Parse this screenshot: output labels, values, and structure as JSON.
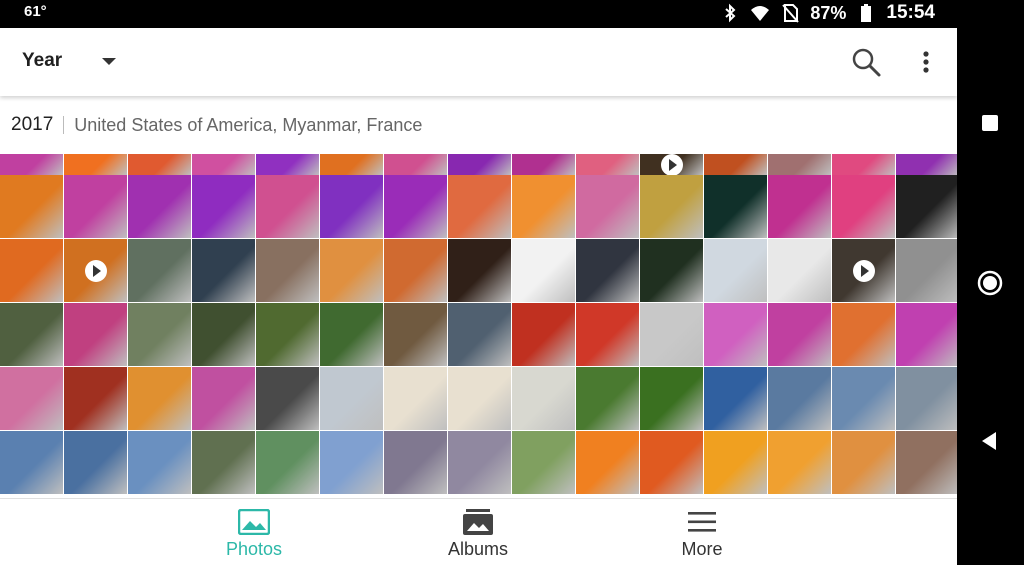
{
  "status_bar": {
    "temperature": "61°",
    "battery": "87%",
    "time": "15:54",
    "icons": [
      "bluetooth-icon",
      "wifi-icon",
      "no-sim-icon",
      "battery-icon"
    ]
  },
  "app_bar": {
    "view_label": "Year",
    "icons": [
      "chevron-down-icon",
      "search-icon",
      "more-vert-icon"
    ]
  },
  "section": {
    "year": "2017",
    "places": "United States of America, Myanmar, France"
  },
  "grid": {
    "row_count": 6,
    "columns": 15,
    "tiles": [
      [
        "#c040a0",
        "#f07020",
        "#e05a30",
        "#d050a0",
        "#9030c0",
        "#e07020",
        "#d05090",
        "#8828b0",
        "#b03090",
        "#e06080",
        "#403020",
        "#c05020",
        "#a07070",
        "#e04a80",
        "#9030b0"
      ],
      [
        "#e07a20",
        "#c040a0",
        "#a030b0",
        "#8f2cc0",
        "#d05090",
        "#8030c0",
        "#9a2cb8",
        "#e06a40",
        "#f09030",
        "#d06aa0",
        "#c0a040",
        "#10302a",
        "#c03090",
        "#e04080",
        "#202020"
      ],
      [
        "#e06a20",
        "#d07020",
        "#607060",
        "#304050",
        "#887060",
        "#e09040",
        "#d06a30",
        "#302018",
        "#f2f2f2",
        "#303540",
        "#203020",
        "#d0d8e0",
        "#e8e8e8",
        "#403830",
        "#909090"
      ],
      [
        "#506040",
        "#c04080",
        "#708060",
        "#405030",
        "#506a30",
        "#406a30",
        "#705a40",
        "#506070",
        "#c03020",
        "#d03828",
        "#c8c8c8",
        "#d060c0",
        "#c040a0",
        "#e07030",
        "#c040b0"
      ],
      [
        "#d070a0",
        "#a03020",
        "#e09030",
        "#c050a0",
        "#4a4a4a",
        "#c0c8d0",
        "#e8e0d0",
        "#e8e0d0",
        "#d8d8d0",
        "#4a7a30",
        "#3a7020",
        "#3060a0",
        "#5a7aa0",
        "#6a8ab0",
        "#8090a0"
      ],
      [
        "#5a80b0",
        "#4a70a0",
        "#6a90c0",
        "#607050",
        "#609060",
        "#80a0d0",
        "#807890",
        "#9088a0",
        "#80a060",
        "#f08020",
        "#e05a20",
        "#f0a020",
        "#f0a030",
        "#e09040",
        "#907060"
      ]
    ],
    "video_tiles": [
      [
        0,
        10
      ],
      [
        2,
        1
      ],
      [
        2,
        13
      ]
    ]
  },
  "bottom_nav": {
    "items": [
      {
        "label": "Photos",
        "icon": "photo-icon",
        "active": true
      },
      {
        "label": "Albums",
        "icon": "albums-icon",
        "active": false
      },
      {
        "label": "More",
        "icon": "menu-icon",
        "active": false
      }
    ]
  },
  "system_nav": {
    "icons": [
      "recents-icon",
      "home-icon",
      "back-icon"
    ]
  },
  "colors": {
    "accent": "#2cb8a8",
    "status_bar": "#000000"
  }
}
